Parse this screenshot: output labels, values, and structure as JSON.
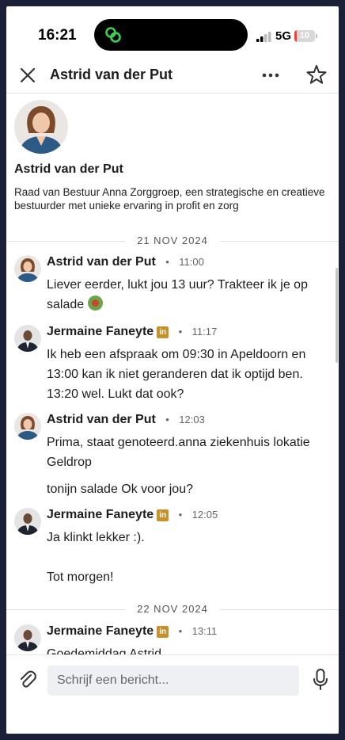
{
  "status_bar": {
    "time": "16:21",
    "network": "5G",
    "battery_level": "10",
    "battery_fraction": 0.1
  },
  "header": {
    "title": "Astrid van der Put"
  },
  "profile": {
    "name": "Astrid van der Put",
    "bio": "Raad van Bestuur Anna Zorggroep,  een strategische en creatieve bestuurder met unieke ervaring in profit en zorg"
  },
  "conversation": {
    "day1": "21 NOV 2024",
    "day2": "22 NOV 2024",
    "messages": [
      {
        "sender": "Astrid van der Put",
        "time": "11:00",
        "lines": [
          "Liever eerder, lukt jou 13 uur? Trakteer ik je op salade"
        ]
      },
      {
        "sender": "Jermaine Faneyte",
        "badge": "in",
        "time": "11:17",
        "lines": [
          "Ik heb een afspraak om 09:30 in Apeldoorn en 13:00 kan ik niet geranderen dat ik optijd ben. 13:20 wel. Lukt dat ook?"
        ]
      },
      {
        "sender": "Astrid van der Put",
        "time": "12:03",
        "lines": [
          "Prima, staat genoteerd.anna ziekenhuis lokatie Geldrop",
          "tonijn salade Ok voor jou?"
        ]
      },
      {
        "sender": "Jermaine Faneyte",
        "badge": "in",
        "time": "12:05",
        "lines": [
          "Ja klinkt lekker :).",
          "Tot morgen!"
        ]
      },
      {
        "sender": "Jermaine Faneyte",
        "badge": "in",
        "time": "13:11",
        "lines": [
          "Goedemiddag Astrid"
        ]
      }
    ]
  },
  "composer": {
    "placeholder": "Schrijf een bericht..."
  },
  "separator_dot": "•"
}
